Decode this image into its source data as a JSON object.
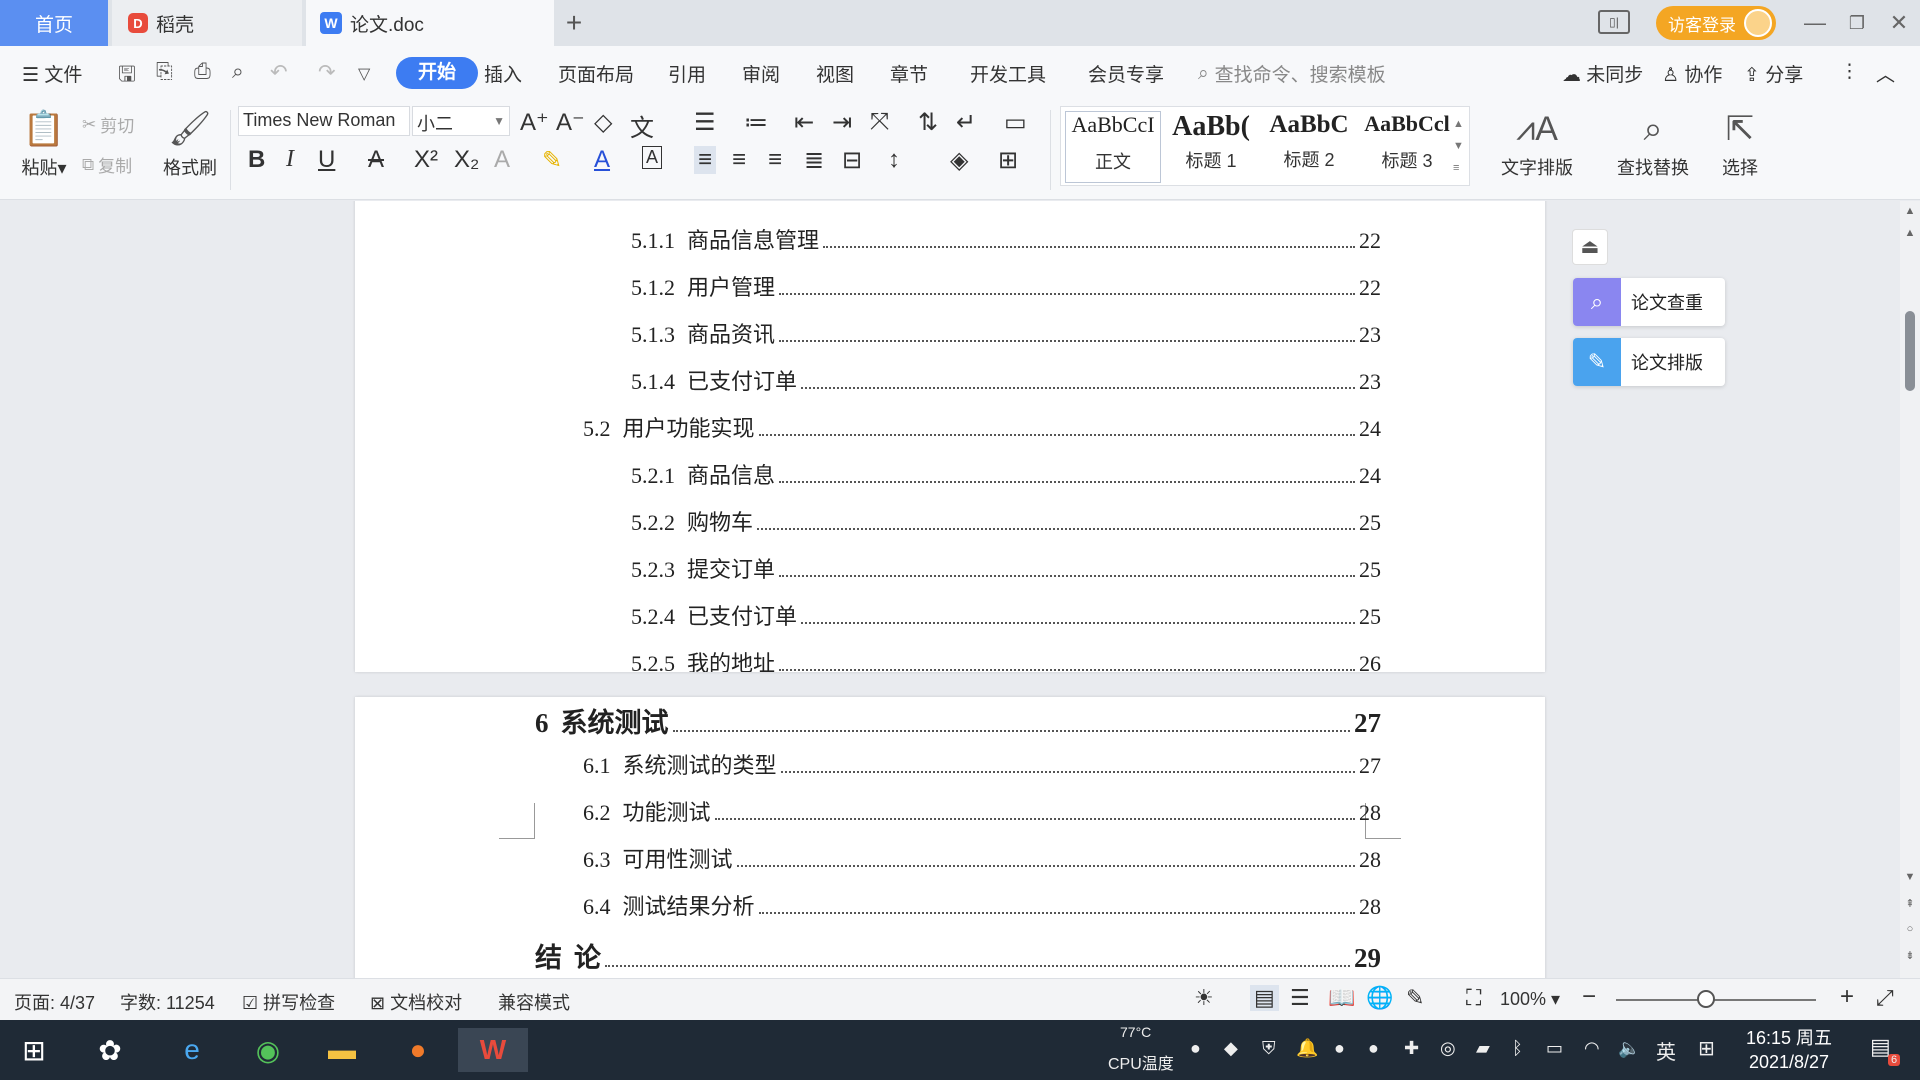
{
  "titlebar": {
    "tabs": [
      {
        "label": "首页"
      },
      {
        "label": "稻壳"
      },
      {
        "label": "论文.doc"
      }
    ],
    "new_tab": "+",
    "visitor_login": "访客登录"
  },
  "menubar": {
    "file": "文件",
    "items": [
      "开始",
      "插入",
      "页面布局",
      "引用",
      "审阅",
      "视图",
      "章节",
      "开发工具",
      "会员专享"
    ],
    "search_placeholder": "查找命令、搜索模板",
    "sync": "未同步",
    "collab": "协作",
    "share": "分享"
  },
  "ribbon": {
    "paste": "粘贴",
    "cut": "剪切",
    "copy": "复制",
    "format_painter": "格式刷",
    "font_name": "Times New Roman",
    "font_size": "小二",
    "styles": [
      {
        "preview": "AaBbCcI",
        "name": "正文"
      },
      {
        "preview": "AaBb(",
        "name": "标题 1"
      },
      {
        "preview": "AaBbC",
        "name": "标题 2"
      },
      {
        "preview": "AaBbCcl",
        "name": "标题 3"
      }
    ],
    "text_layout": "文字排版",
    "find_replace": "查找替换",
    "select": "选择"
  },
  "document": {
    "page1_rows": [
      {
        "num": "5.1.1",
        "title": "商品信息管理",
        "page": "22"
      },
      {
        "num": "5.1.2",
        "title": "用户管理",
        "page": "22"
      },
      {
        "num": "5.1.3",
        "title": "商品资讯",
        "page": "23"
      },
      {
        "num": "5.1.4",
        "title": "已支付订单",
        "page": "23"
      },
      {
        "num": "5.2",
        "title": "用户功能实现",
        "page": "24"
      },
      {
        "num": "5.2.1",
        "title": "商品信息",
        "page": "24"
      },
      {
        "num": "5.2.2",
        "title": "购物车",
        "page": "25"
      },
      {
        "num": "5.2.3",
        "title": "提交订单",
        "page": "25"
      },
      {
        "num": "5.2.4",
        "title": "已支付订单",
        "page": "25"
      },
      {
        "num": "5.2.5",
        "title": "我的地址",
        "page": "26"
      }
    ],
    "page2_rows": [
      {
        "num": "6",
        "title": "系统测试",
        "page": "27"
      },
      {
        "num": "6.1",
        "title": "系统测试的类型",
        "page": "27"
      },
      {
        "num": "6.2",
        "title": "功能测试",
        "page": "28"
      },
      {
        "num": "6.3",
        "title": "可用性测试",
        "page": "28"
      },
      {
        "num": "6.4",
        "title": "测试结果分析",
        "page": "28"
      },
      {
        "num": "结",
        "title": "论",
        "page": "29"
      }
    ]
  },
  "side_panel": {
    "check": "论文查重",
    "format": "论文排版"
  },
  "statusbar": {
    "page": "页面: 4/37",
    "words": "字数: 11254",
    "spell": "拼写检查",
    "proof": "文档校对",
    "compat": "兼容模式",
    "zoom": "100%",
    "zoom_level_percent": 45
  },
  "taskbar": {
    "cpu_temp": "77°C",
    "cpu_label": "CPU温度",
    "ime": "英",
    "time": "16:15 周五",
    "date": "2021/8/27",
    "notif_count": "6"
  }
}
